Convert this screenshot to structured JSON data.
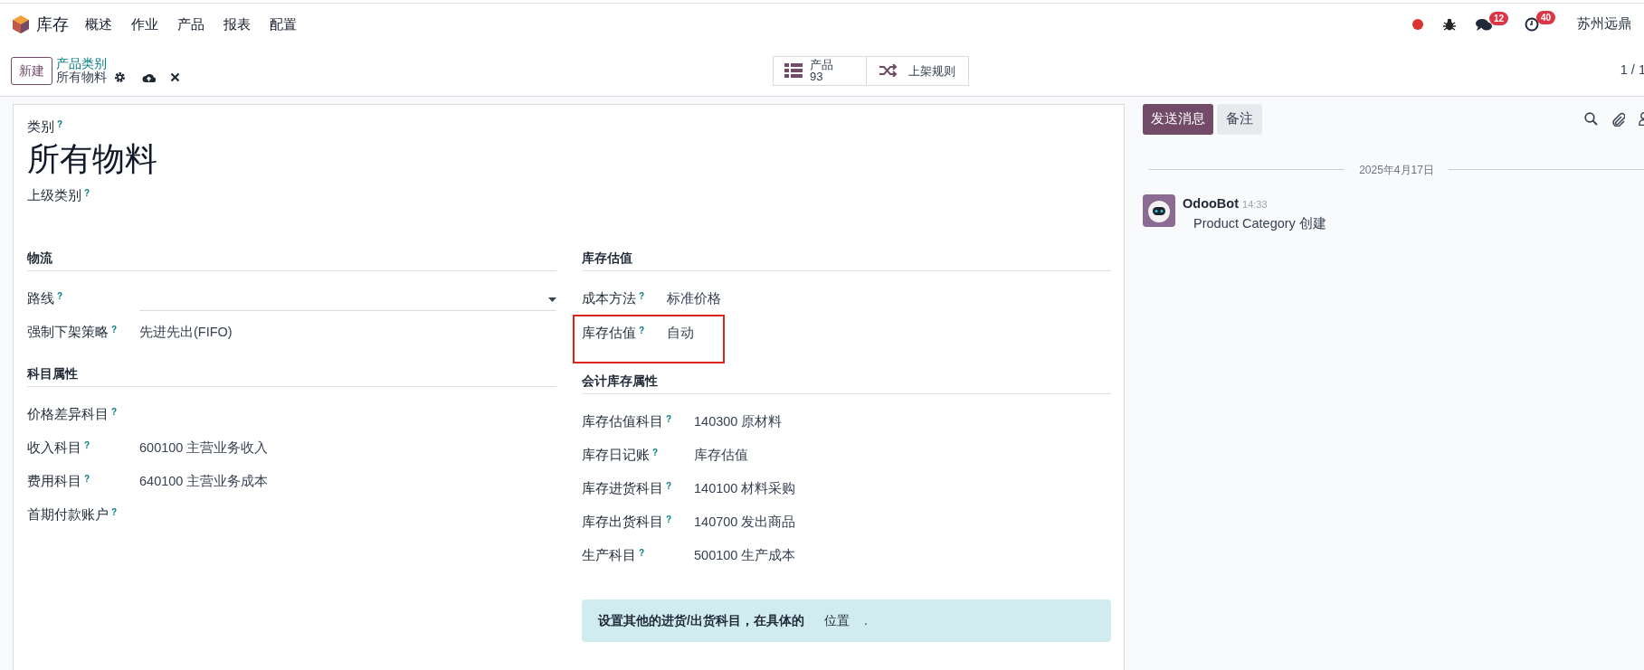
{
  "navbar": {
    "app": "库存",
    "menu": [
      "概述",
      "作业",
      "产品",
      "报表",
      "配置"
    ],
    "messages_badge": "12",
    "activities_badge": "40",
    "company": "苏州远鼎"
  },
  "control_panel": {
    "new_button": "新建",
    "breadcrumb_parent": "产品类别",
    "breadcrumb_current": "所有物料",
    "smart_buttons": [
      {
        "kind": "count",
        "label": "产品",
        "value": "93"
      },
      {
        "kind": "plain",
        "label": "上架规则"
      }
    ],
    "pager": "1 / 1"
  },
  "form": {
    "name_label": "类别",
    "name_help": "?",
    "name": "所有物料",
    "parent_label": "上级类别",
    "parent_help": "?",
    "columns": [
      [
        {
          "title": "物流",
          "fields": [
            {
              "label": "路线",
              "help": "?",
              "kind": "select",
              "highlighted": false
            },
            {
              "label": "强制下架策略",
              "help": "?",
              "kind": "text",
              "value": "先进先出(FIFO)",
              "highlighted": false
            }
          ]
        },
        {
          "title": "科目属性",
          "fields": [
            {
              "label": "价格差异科目",
              "help": "?",
              "kind": "text",
              "highlighted": false
            },
            {
              "label": "收入科目",
              "help": "?",
              "kind": "text",
              "value": "600100 主营业务收入",
              "highlighted": false
            },
            {
              "label": "费用科目",
              "help": "?",
              "kind": "text",
              "value": "640100 主营业务成本",
              "highlighted": false
            },
            {
              "label": "首期付款账户",
              "help": "?",
              "kind": "text",
              "highlighted": false
            }
          ]
        }
      ],
      [
        {
          "title": "库存估值",
          "fields": [
            {
              "label": "成本方法",
              "help": "?",
              "kind": "text",
              "value": "标准价格",
              "highlighted": false
            },
            {
              "label": "库存估值",
              "help": "?",
              "kind": "text",
              "value": "自动",
              "highlighted": true
            }
          ]
        },
        {
          "title": "会计库存属性",
          "fields": [
            {
              "label": "库存估值科目",
              "help": "?",
              "kind": "text",
              "value": "140300 原材料",
              "highlighted": false
            },
            {
              "label": "库存日记账",
              "help": "?",
              "kind": "text",
              "value": "库存估值",
              "highlighted": false
            },
            {
              "label": "库存进货科目",
              "help": "?",
              "kind": "text",
              "value": "140100 材料采购",
              "highlighted": false
            },
            {
              "label": "库存出货科目",
              "help": "?",
              "kind": "text",
              "value": "140700 发出商品",
              "highlighted": false
            },
            {
              "label": "生产科目",
              "help": "?",
              "kind": "text",
              "value": "500100 生产成本",
              "highlighted": false
            }
          ],
          "alert": {
            "text": "设置其他的进货/出货科目，在具体的",
            "link": "位置",
            "tail": "."
          }
        }
      ]
    ]
  },
  "chatter": {
    "send_button": "发送消息",
    "note_button": "备注",
    "date": "2025年4月17日",
    "messages": [
      {
        "author": "OdooBot",
        "time": "14:33",
        "body": "Product Category 创建"
      }
    ]
  }
}
